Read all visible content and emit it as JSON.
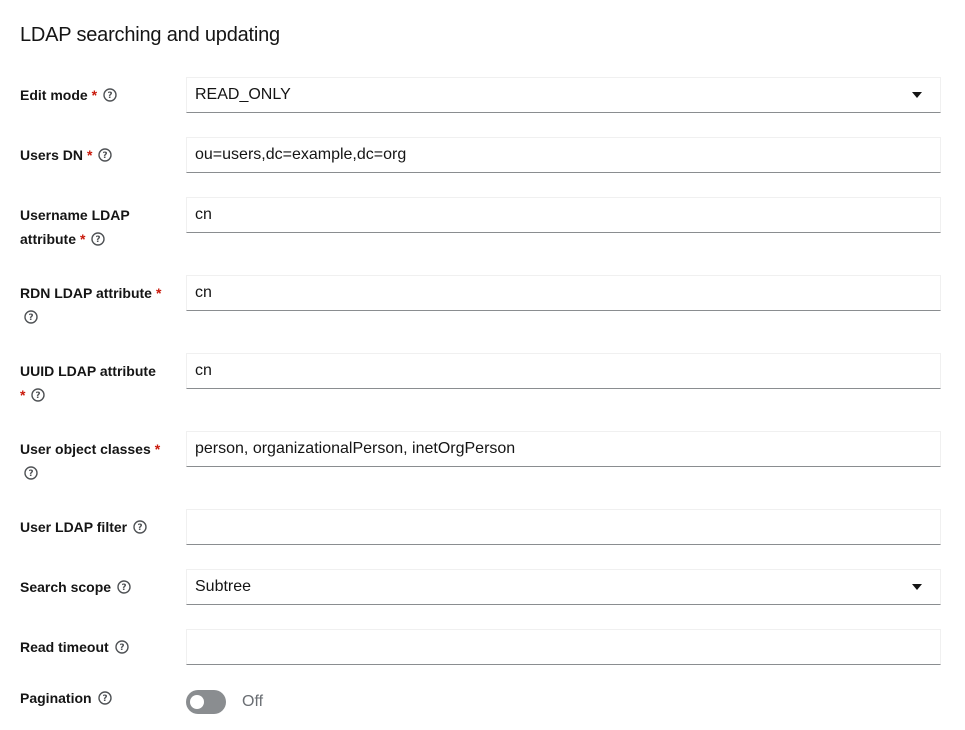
{
  "section": {
    "title": "LDAP searching and updating"
  },
  "fields": {
    "edit_mode": {
      "label": "Edit mode",
      "required": "*",
      "value": "READ_ONLY"
    },
    "users_dn": {
      "label": "Users DN",
      "required": "*",
      "value": "ou=users,dc=example,dc=org"
    },
    "username_ldap_attribute": {
      "label_line1": "Username LDAP",
      "label_line2": "attribute",
      "required": "*",
      "value": "cn"
    },
    "rdn_ldap_attribute": {
      "label": "RDN LDAP attribute",
      "required": "*",
      "value": "cn"
    },
    "uuid_ldap_attribute": {
      "label": "UUID LDAP attribute",
      "required": "*",
      "value": "cn"
    },
    "user_object_classes": {
      "label": "User object classes",
      "required": "*",
      "value": "person, organizationalPerson, inetOrgPerson"
    },
    "user_ldap_filter": {
      "label": "User LDAP filter",
      "value": ""
    },
    "search_scope": {
      "label": "Search scope",
      "value": "Subtree"
    },
    "read_timeout": {
      "label": "Read timeout",
      "value": ""
    },
    "pagination": {
      "label": "Pagination",
      "state": "Off"
    }
  },
  "icons": {
    "help": "help-circle-icon",
    "caret": "caret-down-icon"
  },
  "colors": {
    "required": "#c9190b",
    "switch_off": "#8a8d90",
    "field_border": "#8a8d90"
  }
}
